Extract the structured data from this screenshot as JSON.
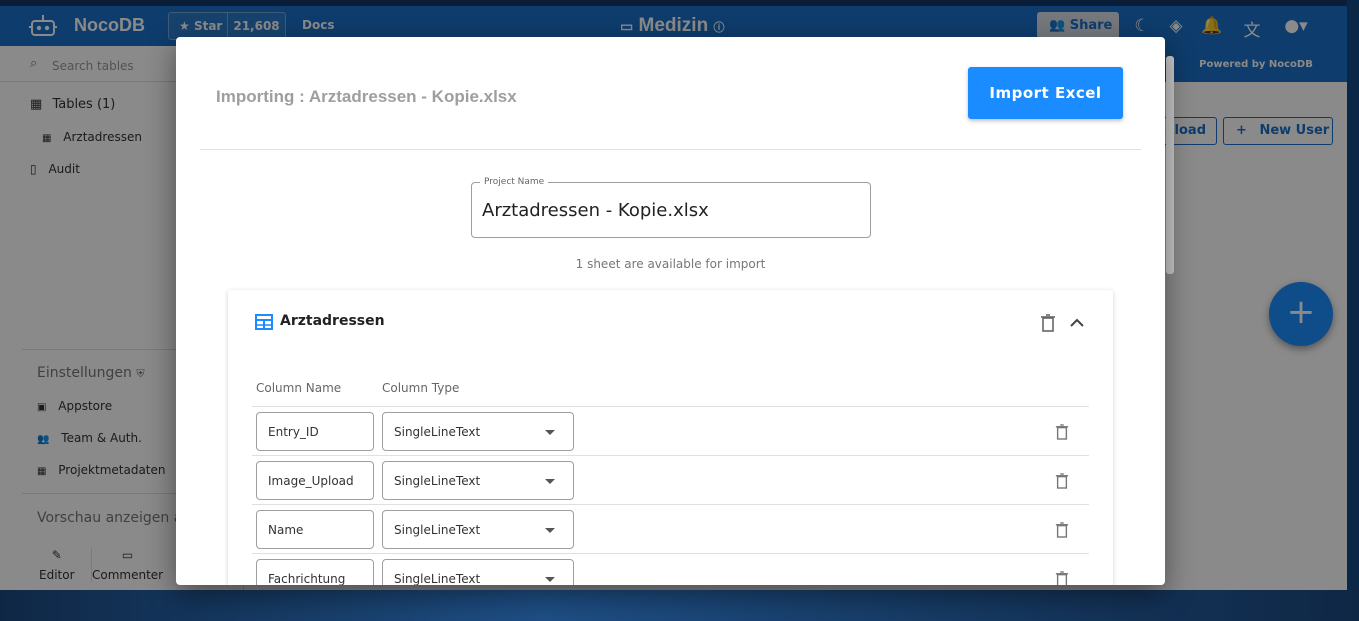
{
  "app": {
    "brand": "NocoDB",
    "github": {
      "star_label": "Star",
      "count": "21,608"
    },
    "docs_label": "Docs",
    "project_title": "Medizin",
    "share_label": "Share",
    "powered_by": "Powered by NocoDB",
    "colors": {
      "navbar": "#1b6fc8",
      "accent": "#1a8cff"
    }
  },
  "sidebar": {
    "search_placeholder": "Search tables",
    "tables_label": "Tables (1)",
    "table_items": [
      "Arztadressen"
    ],
    "audit_label": "Audit",
    "settings_heading": "Einstellungen",
    "settings_items": [
      "Appstore",
      "Team & Auth.",
      "Projektmetadaten"
    ],
    "preview_label": "Vorschau anzeigen al",
    "roles": [
      "Editor",
      "Commenter"
    ]
  },
  "main": {
    "reload_label": "Reload",
    "new_user_label": "New User",
    "fab_icon": "plus-icon"
  },
  "dialog": {
    "title": "Importing : Arztadressen - Kopie.xlsx",
    "import_button": "Import Excel",
    "project_name_label": "Project Name",
    "project_name_value": "Arztadressen - Kopie.xlsx",
    "sheet_info": "1 sheet are available for import",
    "sheet": {
      "name": "Arztadressen",
      "col_name_header": "Column Name",
      "col_type_header": "Column Type",
      "columns": [
        {
          "name": "Entry_ID",
          "type": "SingleLineText"
        },
        {
          "name": "Image_Upload",
          "type": "SingleLineText"
        },
        {
          "name": "Name",
          "type": "SingleLineText"
        },
        {
          "name": "Fachrichtung",
          "type": "SingleLineText"
        }
      ]
    }
  }
}
